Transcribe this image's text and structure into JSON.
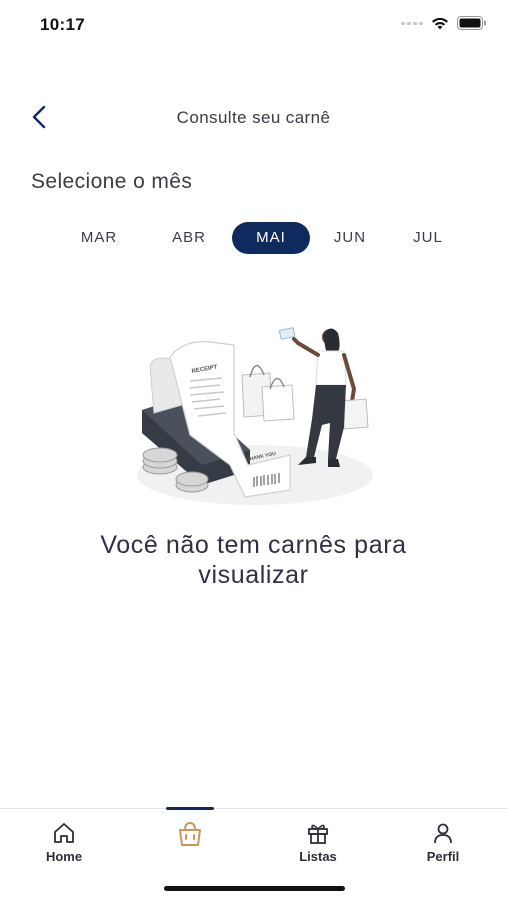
{
  "status_bar": {
    "time": "10:17"
  },
  "header": {
    "title": "Consulte seu carnê",
    "back_icon": "chevron-left-icon"
  },
  "month_selector": {
    "label": "Selecione o mês",
    "months": [
      "MAR",
      "ABR",
      "MAI",
      "JUN",
      "JUL"
    ],
    "selected": "MAI"
  },
  "empty_state": {
    "illustration_icon": "receipt-shopping-illustration",
    "message_line1": "Você não tem carnês para",
    "message_line2": "visualizar",
    "receipt_header": "RECEIPT",
    "receipt_footer": "THANK YOU"
  },
  "tabbar": {
    "items": [
      {
        "label": "Home",
        "icon": "home-icon"
      },
      {
        "label": "",
        "icon": "shopping-bag-icon",
        "active": true
      },
      {
        "label": "Listas",
        "icon": "gift-icon"
      },
      {
        "label": "Perfil",
        "icon": "user-icon"
      }
    ]
  },
  "colors": {
    "primary": "#0f2a5c",
    "accent": "#c9955a",
    "text": "#2d2f38"
  }
}
